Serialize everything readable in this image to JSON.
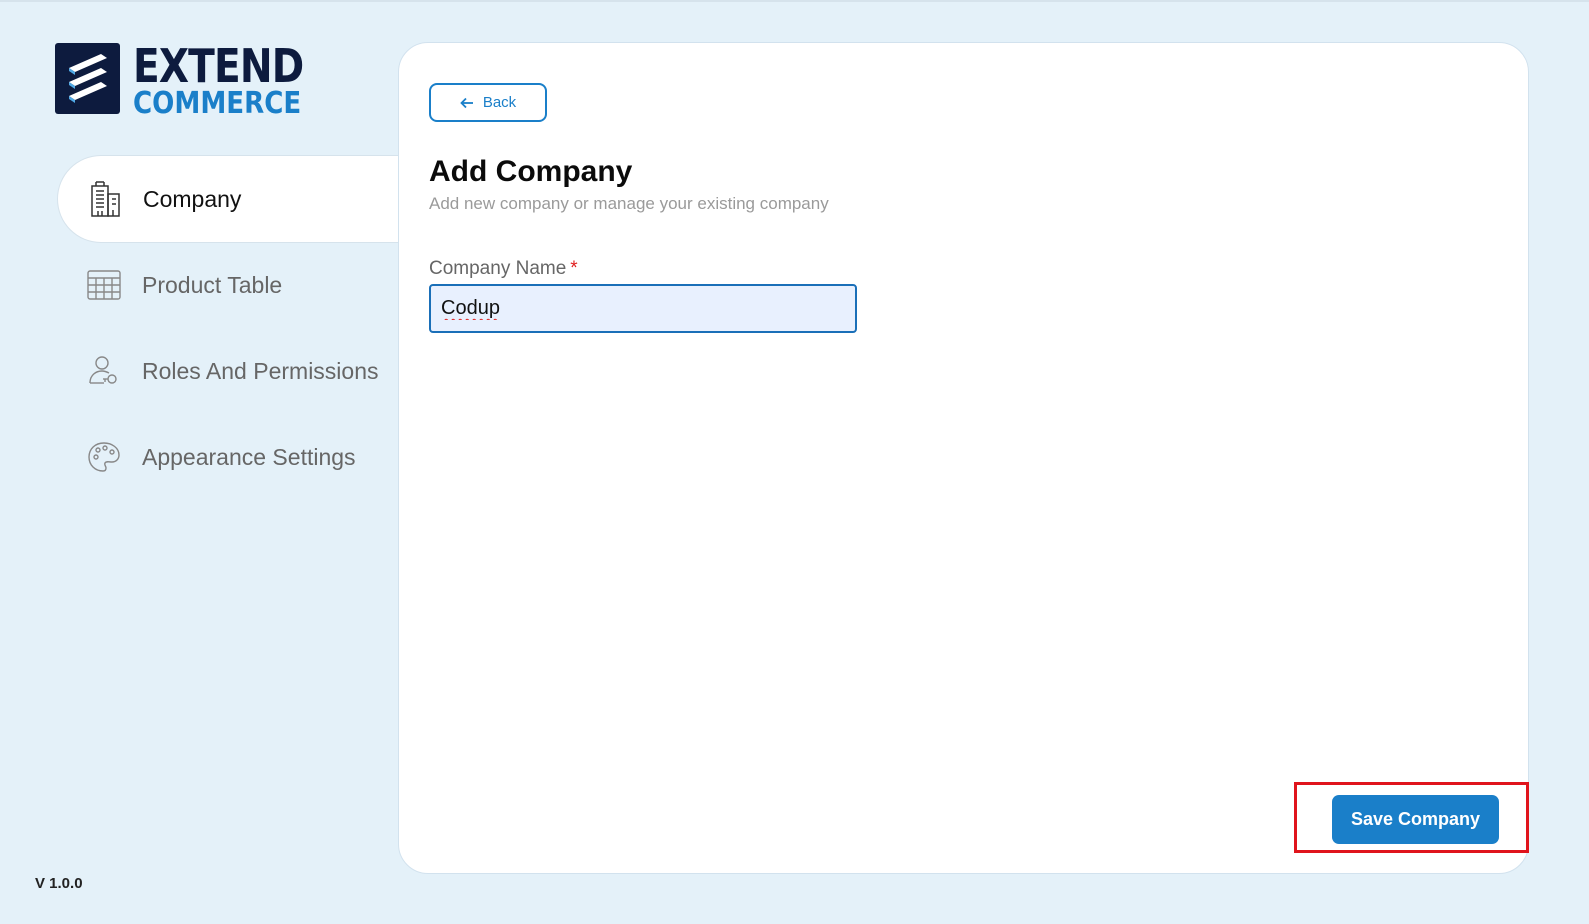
{
  "brand": {
    "line1": "EXTEND",
    "line2": "COMMERCE",
    "primary_color": "#0d1b3e",
    "accent_color": "#1a7fc9"
  },
  "sidebar": {
    "items": [
      {
        "label": "Company",
        "icon": "building-icon",
        "active": true
      },
      {
        "label": "Product Table",
        "icon": "table-icon",
        "active": false
      },
      {
        "label": "Roles And Permissions",
        "icon": "user-key-icon",
        "active": false
      },
      {
        "label": "Appearance Settings",
        "icon": "palette-icon",
        "active": false
      }
    ],
    "version": "V 1.0.0"
  },
  "main": {
    "back_label": "Back",
    "title": "Add Company",
    "subtitle": "Add new company or manage your existing company",
    "company_name": {
      "label": "Company Name",
      "required_marker": "*",
      "value": "Codup"
    },
    "save_label": "Save Company"
  },
  "highlight": {
    "target": "save-company-button",
    "color": "#e0141c"
  }
}
